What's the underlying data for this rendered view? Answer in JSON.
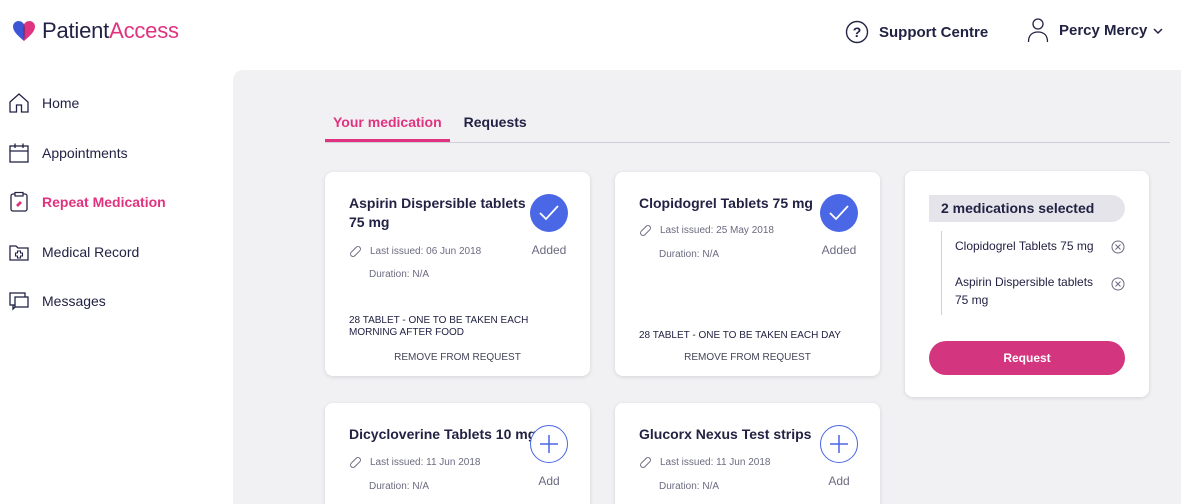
{
  "brand": {
    "word1": "Patient",
    "word2": "Access"
  },
  "header": {
    "support_label": "Support Centre",
    "user_name": "Percy Mercy"
  },
  "sidebar": {
    "items": [
      {
        "label": "Home",
        "icon": "home-icon"
      },
      {
        "label": "Appointments",
        "icon": "calendar-icon"
      },
      {
        "label": "Repeat Medication",
        "icon": "medication-icon",
        "active": true
      },
      {
        "label": "Medical Record",
        "icon": "medical-record-icon"
      },
      {
        "label": "Messages",
        "icon": "messages-icon"
      }
    ]
  },
  "tabs": [
    {
      "label": "Your medication",
      "active": true
    },
    {
      "label": "Requests"
    }
  ],
  "medications": [
    {
      "name": "Aspirin Dispersible tablets 75 mg",
      "last_issued": "Last issued: 06 Jun 2018",
      "duration": "Duration: N/A",
      "status": "Added",
      "dosage": "28 TABLET - ONE TO BE TAKEN EACH MORNING AFTER FOOD",
      "action": "REMOVE FROM REQUEST"
    },
    {
      "name": "Clopidogrel Tablets 75 mg",
      "last_issued": "Last issued: 25 May 2018",
      "duration": "Duration: N/A",
      "status": "Added",
      "dosage": "28 TABLET - ONE TO BE TAKEN EACH DAY",
      "action": "REMOVE FROM REQUEST"
    },
    {
      "name": "Dicycloverine Tablets 10 mg",
      "last_issued": "Last issued: 11 Jun 2018",
      "duration": "Duration: N/A",
      "status": "Add"
    },
    {
      "name": "Glucorx Nexus Test strips",
      "last_issued": "Last issued: 11 Jun 2018",
      "duration": "Duration: N/A",
      "status": "Add"
    }
  ],
  "selection": {
    "header": "2 medications selected",
    "items": [
      "Clopidogrel Tablets 75 mg",
      "Aspirin Dispersible tablets 75 mg"
    ],
    "button_label": "Request"
  },
  "colors": {
    "accent": "#e0337f",
    "primary_blue": "#4a67e6",
    "panel_bg": "#f1f1f4"
  }
}
